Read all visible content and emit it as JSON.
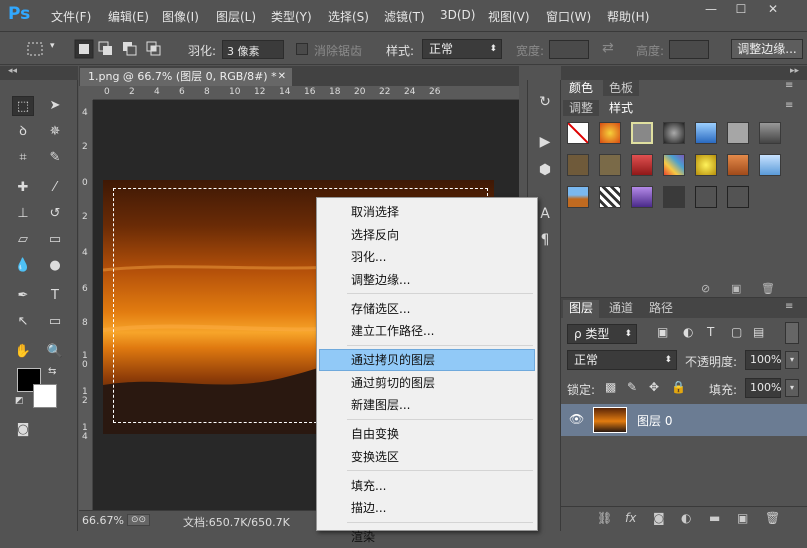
{
  "app": {
    "logo": "Ps"
  },
  "menu": [
    "文件(F)",
    "编辑(E)",
    "图像(I)",
    "图层(L)",
    "类型(Y)",
    "选择(S)",
    "滤镜(T)",
    "3D(D)",
    "视图(V)",
    "窗口(W)",
    "帮助(H)"
  ],
  "window_controls": {
    "minimize": "—",
    "maximize": "☐",
    "close": "✕"
  },
  "options": {
    "feather_label": "羽化:",
    "feather_value": "3 像素",
    "antialias_label": "消除锯齿",
    "style_label": "样式:",
    "style_value": "正常",
    "width_label": "宽度:",
    "height_label": "高度:",
    "refine_button": "调整边缘..."
  },
  "document": {
    "tab_title": "1.png @ 66.7% (图层 0, RGB/8#) *",
    "ruler_top": [
      "0",
      "2",
      "4",
      "6",
      "8",
      "10",
      "12",
      "14",
      "16",
      "18",
      "20",
      "22",
      "24",
      "26"
    ],
    "ruler_left": [
      "4",
      "2",
      "0",
      "2",
      "4",
      "6",
      "8",
      "1\n0",
      "1\n2",
      "1\n4"
    ],
    "zoom": "66.67%",
    "doc_size": "文档:650.7K/650.7K"
  },
  "context_menu": {
    "groups": [
      [
        "取消选择",
        "选择反向",
        "羽化...",
        "调整边缘..."
      ],
      [
        "存储选区...",
        "建立工作路径..."
      ],
      [
        "通过拷贝的图层",
        "通过剪切的图层",
        "新建图层..."
      ],
      [
        "自由变换",
        "变换选区"
      ],
      [
        "填充...",
        "描边..."
      ],
      [
        "渲染"
      ]
    ],
    "highlighted": "通过拷贝的图层"
  },
  "panels": {
    "top_tabs_row1": [
      "颜色",
      "色板"
    ],
    "top_tabs_row2": [
      "调整",
      "样式"
    ],
    "layers_tabs": [
      "图层",
      "通道",
      "路径"
    ],
    "kind_label": "ρ 类型",
    "blend_mode": "正常",
    "opacity_label": "不透明度:",
    "opacity_value": "100%",
    "lock_label": "锁定:",
    "fill_label": "填充:",
    "fill_value": "100%",
    "layer_name": "图层 0"
  },
  "style_swatch_colors": [
    "#ffffff",
    "#d84a12",
    "#888888",
    "#3b3b3b",
    "#3f86d6",
    "#a6a6a6",
    "#6b6b6b",
    "#6f5a3a",
    "#7a6a48",
    "#c02b2b",
    "#4aa0d0",
    "#e2c61a",
    "#c86a2a",
    "#7fb2e0",
    "#8aa3b8",
    "#cfcfcf",
    "#7b5ab8",
    "#3a3a3a",
    "#535353",
    "#535353"
  ]
}
